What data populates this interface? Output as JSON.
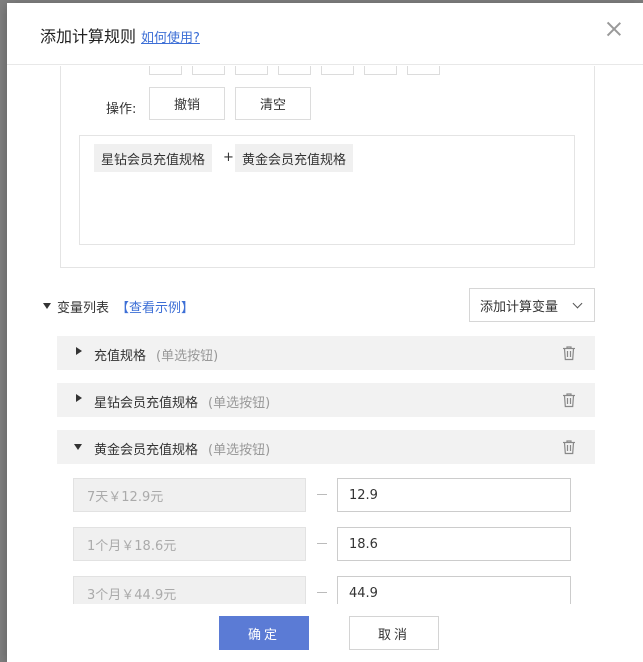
{
  "dialog": {
    "title": "添加计算规则",
    "help_link": "如何使用?",
    "close_icon": "close-icon"
  },
  "formula": {
    "operation_label": "操作:",
    "undo_label": "撤销",
    "clear_label": "清空",
    "tokens": [
      "星钻会员充值规格",
      "黄金会员充值规格"
    ],
    "operator": "+"
  },
  "variables": {
    "title": "变量列表",
    "example_link": "【查看示例】",
    "add_button": "添加计算变量",
    "items": [
      {
        "name": "充值规格",
        "type": "(单选按钮)",
        "expanded": false
      },
      {
        "name": "星钻会员充值规格",
        "type": "(单选按钮)",
        "expanded": false
      },
      {
        "name": "黄金会员充值规格",
        "type": "(单选按钮)",
        "expanded": true
      }
    ],
    "options": [
      {
        "label": "7天￥12.9元",
        "value": "12.9"
      },
      {
        "label": "1个月￥18.6元",
        "value": "18.6"
      },
      {
        "label": "3个月￥44.9元",
        "value": "44.9"
      }
    ]
  },
  "footer": {
    "ok_label": "确定",
    "cancel_label": "取消"
  },
  "colors": {
    "accent": "#5b7bd5",
    "link": "#3d6fd6"
  }
}
